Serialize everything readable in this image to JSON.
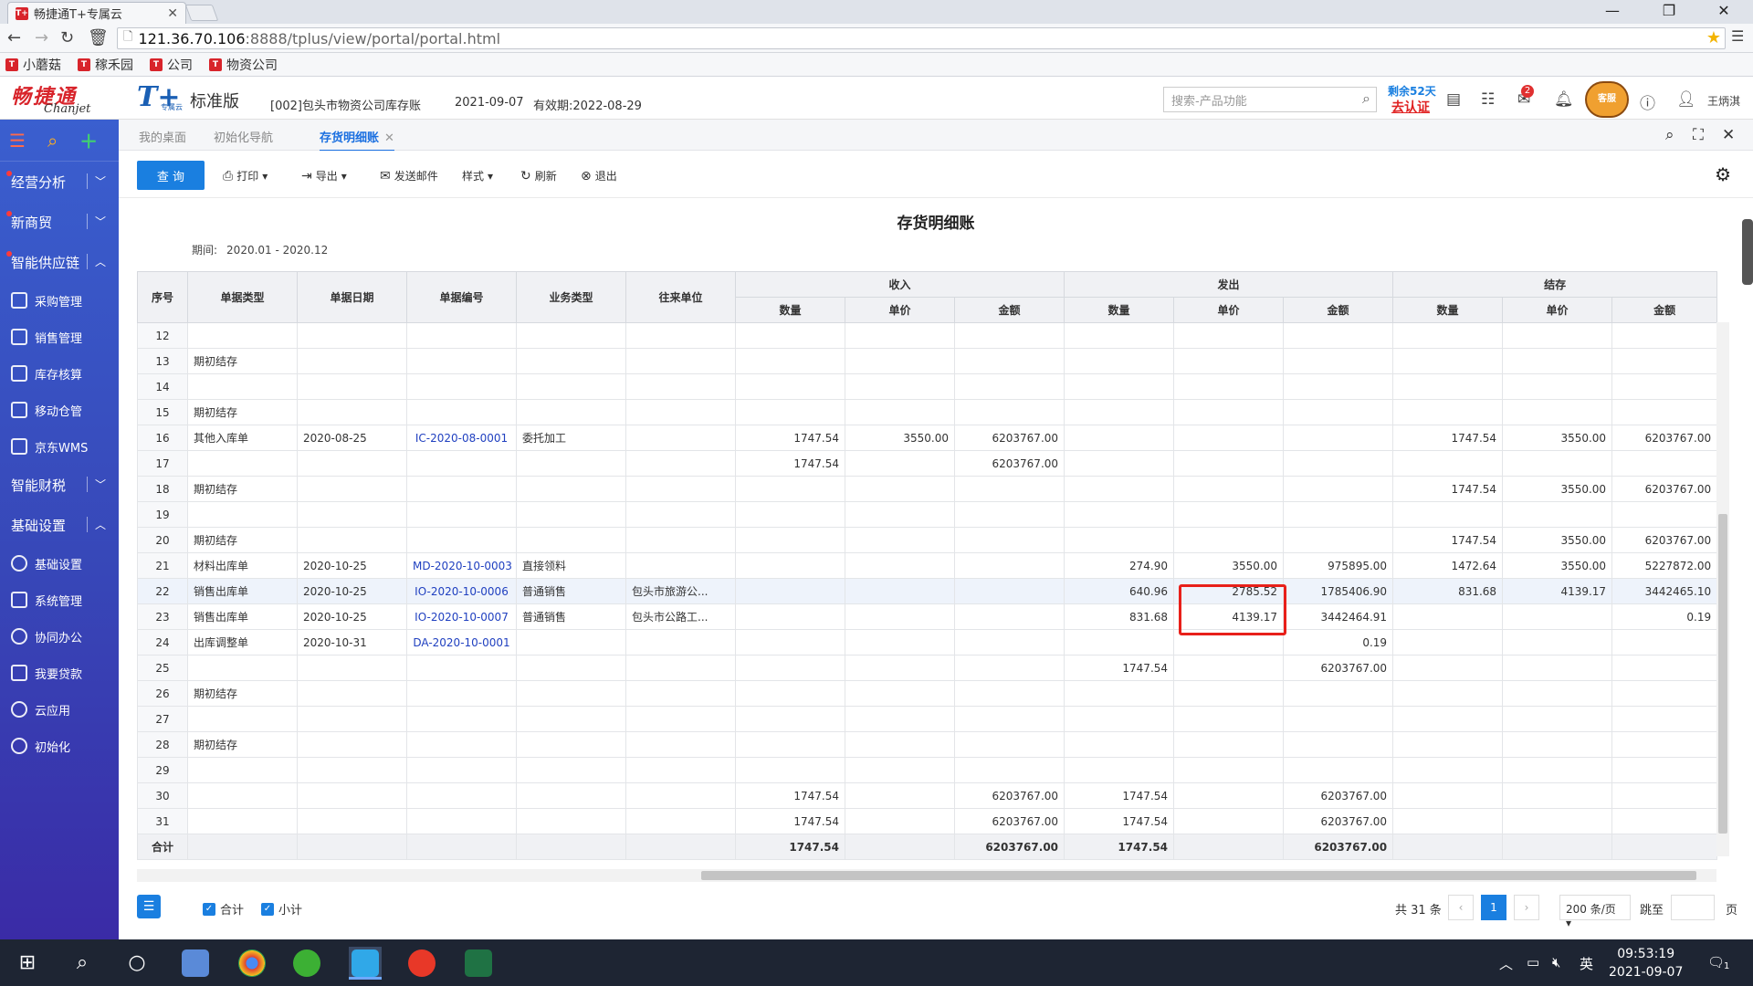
{
  "browser": {
    "tab_title": "畅捷通T+专属云",
    "favicon": "T+",
    "url_host": "121.36.70.106",
    "url_path": ":8888/tplus/view/portal/portal.html",
    "bookmarks": [
      "小蘑菇",
      "稼禾园",
      "公司",
      "物资公司"
    ]
  },
  "header": {
    "logo_cn": "畅捷通",
    "logo_en": "Chanjet",
    "product": "T+",
    "product_sub": "专属云",
    "edition": "标准版",
    "company": "[002]包头市物资公司库存账",
    "system_date": "2021-09-07",
    "valid_until": "有效期:2022-08-29",
    "search_placeholder": "搜索-产品功能",
    "remain_days": "剩余52天",
    "certify": "去认证",
    "notification_count": "2",
    "kefu": "客服",
    "user": "王炳淇"
  },
  "sidebar": {
    "groups": [
      {
        "label": "经营分析",
        "expanded": false
      },
      {
        "label": "新商贸",
        "expanded": false
      },
      {
        "label": "智能供应链",
        "expanded": true
      }
    ],
    "supply_items": [
      "采购管理",
      "销售管理",
      "库存核算",
      "移动仓管",
      "京东WMS"
    ],
    "group_finance": "智能财税",
    "group_basic": "基础设置",
    "basic_items": [
      "基础设置",
      "系统管理",
      "协同办公",
      "我要贷款",
      "云应用",
      "初始化"
    ]
  },
  "tabs": [
    {
      "label": "我的桌面"
    },
    {
      "label": "初始化导航"
    },
    {
      "label": "存货明细账",
      "active": true
    }
  ],
  "toolbar": {
    "query": "查 询",
    "print": "打印",
    "export": "导出",
    "send_mail": "发送邮件",
    "style": "样式",
    "refresh": "刷新",
    "exit": "退出"
  },
  "report": {
    "title": "存货明细账",
    "period_label": "期间:",
    "period_value": "2020.01 - 2020.12"
  },
  "table": {
    "headers": {
      "seq": "序号",
      "doc_type": "单据类型",
      "doc_date": "单据日期",
      "doc_no": "单据编号",
      "biz_type": "业务类型",
      "partner": "往来单位",
      "in": "收入",
      "out": "发出",
      "bal": "结存",
      "qty": "数量",
      "price": "单价",
      "amount": "金额"
    },
    "rows": [
      [
        "12",
        "",
        "",
        "",
        "",
        "",
        "",
        "",
        "",
        "",
        "",
        "",
        "",
        "",
        ""
      ],
      [
        "13",
        "期初结存",
        "",
        "",
        "",
        "",
        "",
        "",
        "",
        "",
        "",
        "",
        "",
        "",
        ""
      ],
      [
        "14",
        "",
        "",
        "",
        "",
        "",
        "",
        "",
        "",
        "",
        "",
        "",
        "",
        "",
        ""
      ],
      [
        "15",
        "期初结存",
        "",
        "",
        "",
        "",
        "",
        "",
        "",
        "",
        "",
        "",
        "",
        "",
        ""
      ],
      [
        "16",
        "其他入库单",
        "2020-08-25",
        "IC-2020-08-0001",
        "委托加工",
        "",
        "1747.54",
        "3550.00",
        "6203767.00",
        "",
        "",
        "",
        "1747.54",
        "3550.00",
        "6203767.00"
      ],
      [
        "17",
        "",
        "",
        "",
        "",
        "",
        "1747.54",
        "",
        "6203767.00",
        "",
        "",
        "",
        "",
        "",
        ""
      ],
      [
        "18",
        "期初结存",
        "",
        "",
        "",
        "",
        "",
        "",
        "",
        "",
        "",
        "",
        "1747.54",
        "3550.00",
        "6203767.00"
      ],
      [
        "19",
        "",
        "",
        "",
        "",
        "",
        "",
        "",
        "",
        "",
        "",
        "",
        "",
        "",
        ""
      ],
      [
        "20",
        "期初结存",
        "",
        "",
        "",
        "",
        "",
        "",
        "",
        "",
        "",
        "",
        "1747.54",
        "3550.00",
        "6203767.00"
      ],
      [
        "21",
        "材料出库单",
        "2020-10-25",
        "MD-2020-10-0003",
        "直接领料",
        "",
        "",
        "",
        "",
        "274.90",
        "3550.00",
        "975895.00",
        "1472.64",
        "3550.00",
        "5227872.00"
      ],
      [
        "22",
        "销售出库单",
        "2020-10-25",
        "IO-2020-10-0006",
        "普通销售",
        "包头市旅游公...",
        "",
        "",
        "",
        "640.96",
        "2785.52",
        "1785406.90",
        "831.68",
        "4139.17",
        "3442465.10"
      ],
      [
        "23",
        "销售出库单",
        "2020-10-25",
        "IO-2020-10-0007",
        "普通销售",
        "包头市公路工...",
        "",
        "",
        "",
        "831.68",
        "4139.17",
        "3442464.91",
        "",
        "",
        "0.19"
      ],
      [
        "24",
        "出库调整单",
        "2020-10-31",
        "DA-2020-10-0001",
        "",
        "",
        "",
        "",
        "",
        "",
        "",
        "0.19",
        "",
        "",
        ""
      ],
      [
        "25",
        "",
        "",
        "",
        "",
        "",
        "",
        "",
        "",
        "1747.54",
        "",
        "6203767.00",
        "",
        "",
        ""
      ],
      [
        "26",
        "期初结存",
        "",
        "",
        "",
        "",
        "",
        "",
        "",
        "",
        "",
        "",
        "",
        "",
        ""
      ],
      [
        "27",
        "",
        "",
        "",
        "",
        "",
        "",
        "",
        "",
        "",
        "",
        "",
        "",
        "",
        ""
      ],
      [
        "28",
        "期初结存",
        "",
        "",
        "",
        "",
        "",
        "",
        "",
        "",
        "",
        "",
        "",
        "",
        ""
      ],
      [
        "29",
        "",
        "",
        "",
        "",
        "",
        "",
        "",
        "",
        "",
        "",
        "",
        "",
        "",
        ""
      ],
      [
        "30",
        "",
        "",
        "",
        "",
        "",
        "1747.54",
        "",
        "6203767.00",
        "1747.54",
        "",
        "6203767.00",
        "",
        "",
        ""
      ],
      [
        "31",
        "",
        "",
        "",
        "",
        "",
        "1747.54",
        "",
        "6203767.00",
        "1747.54",
        "",
        "6203767.00",
        "",
        "",
        ""
      ]
    ],
    "total": [
      "合计",
      "",
      "",
      "",
      "",
      "",
      "1747.54",
      "",
      "6203767.00",
      "1747.54",
      "",
      "6203767.00",
      "",
      "",
      ""
    ]
  },
  "footer": {
    "chk_total": "合计",
    "chk_subtotal": "小计",
    "total_count": "共 31 条",
    "current_page": "1",
    "page_size": "200 条/页",
    "jump_to": "跳至",
    "page": "页"
  },
  "taskbar": {
    "time": "09:53:19",
    "date": "2021-09-07",
    "ime": "英",
    "notify_count": "1"
  },
  "colors": {
    "accent": "#1a7fe0",
    "sidebar_top": "#3a5fcf",
    "sidebar_bottom": "#3a2ba6",
    "highlight_box": "#e8201a",
    "link": "#2040c0"
  }
}
